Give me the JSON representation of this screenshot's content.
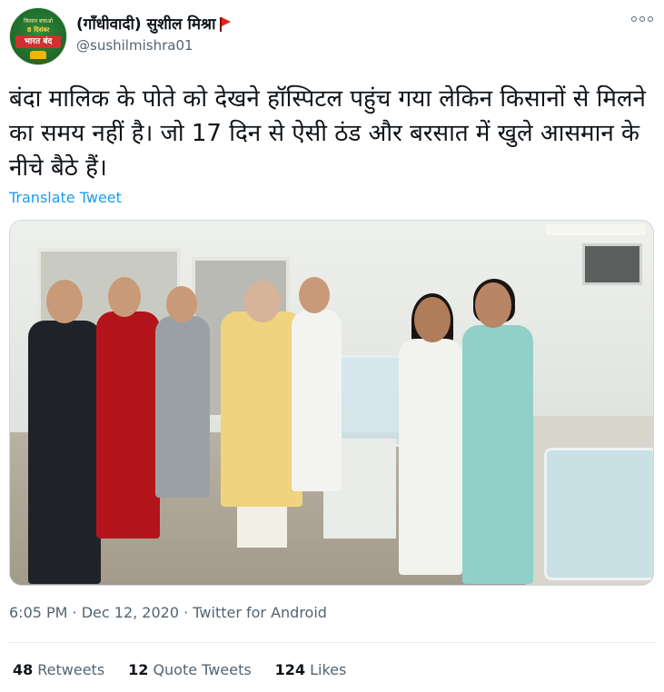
{
  "user": {
    "display_name": "(गाँधीवादी) सुशील मिश्रा",
    "handle": "@sushilmishra01",
    "avatar_text": {
      "top": "किसान बचाओ",
      "middle": "8 दिसंबर",
      "band": "भारत बंद"
    }
  },
  "tweet": {
    "text": "बंदा मालिक के पोते को देखने हॉस्पिटल पहुंच गया लेकिन किसानों से मिलने का समय नहीं है। जो 17 दिन से ऐसी ठंड और बरसात में खुले आसमान के नीचे बैठे हैं।",
    "translate_label": "Translate Tweet",
    "timestamp": "6:05 PM · Dec 12, 2020 · Twitter for Android"
  },
  "stats": {
    "retweets_count": "48",
    "retweets_label": "Retweets",
    "quotes_count": "12",
    "quotes_label": "Quote Tweets",
    "likes_count": "124",
    "likes_label": "Likes"
  },
  "icons": {
    "more": "more-icon",
    "flag": "flag-icon"
  },
  "colors": {
    "link": "#1d9bf0",
    "secondary_text": "#536471",
    "primary_text": "#0f1419"
  }
}
